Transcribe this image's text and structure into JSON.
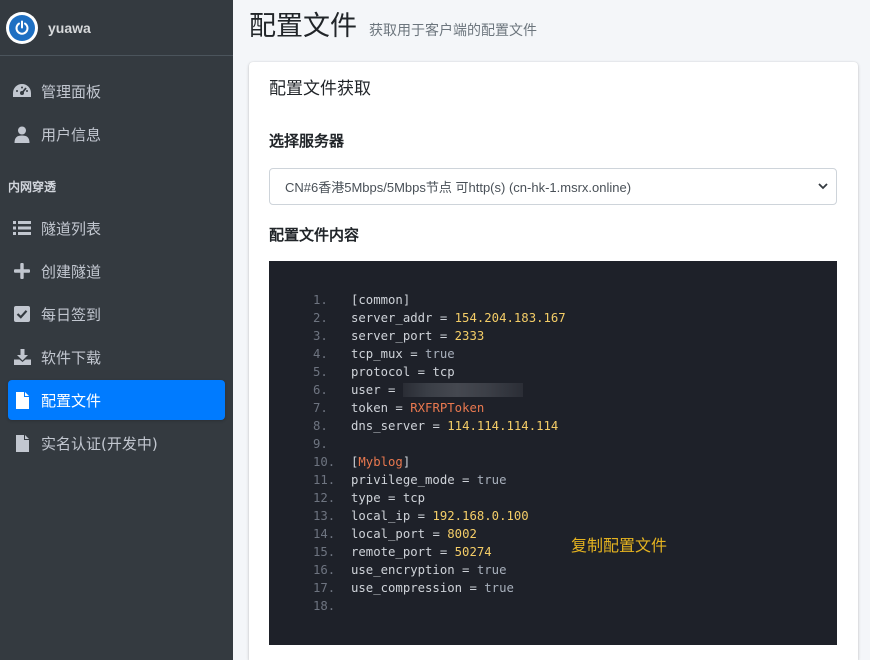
{
  "brand": {
    "name": "yuawa"
  },
  "sidebar": {
    "items_top": [
      {
        "label": "管理面板",
        "icon": "dashboard-icon"
      },
      {
        "label": "用户信息",
        "icon": "user-icon"
      }
    ],
    "section_header": "内网穿透",
    "items": [
      {
        "label": "隧道列表",
        "icon": "list-icon"
      },
      {
        "label": "创建隧道",
        "icon": "plus-icon"
      },
      {
        "label": "每日签到",
        "icon": "check-square-icon"
      },
      {
        "label": "软件下载",
        "icon": "download-icon"
      },
      {
        "label": "配置文件",
        "icon": "file-icon",
        "active": true
      },
      {
        "label": "实名认证(开发中)",
        "icon": "file-icon"
      }
    ]
  },
  "header": {
    "title": "配置文件",
    "subtitle": "获取用于客户端的配置文件"
  },
  "card": {
    "title": "配置文件获取",
    "server_label": "选择服务器",
    "server_selected": "CN#6香港5Mbps/5Mbps节点 可http(s) (cn-hk-1.msrx.online)",
    "content_label": "配置文件内容",
    "copy_label": "复制配置文件"
  },
  "code": {
    "line_numbers": [
      "1.",
      "2.",
      "3.",
      "4.",
      "5.",
      "6.",
      "7.",
      "8.",
      "9.",
      "10.",
      "11.",
      "12.",
      "13.",
      "14.",
      "15.",
      "16.",
      "17.",
      "18."
    ],
    "common_section": "common",
    "server_addr": "154.204.183.167",
    "server_port": "2333",
    "tcp_mux": "true",
    "protocol": "tcp",
    "token": "RXFRPToken",
    "dns_server": "114.114.114.114",
    "tunnel_section": "Myblog",
    "privilege_mode": "true",
    "type": "tcp",
    "local_ip": "192.168.0.100",
    "local_port": "8002",
    "remote_port": "50274",
    "use_encryption": "true",
    "use_compression": "true",
    "keys": {
      "server_addr": "server_addr",
      "server_port": "server_port",
      "tcp_mux": "tcp_mux",
      "protocol": "protocol",
      "user": "user",
      "token": "token",
      "dns_server": "dns_server",
      "privilege_mode": "privilege_mode",
      "type": "type",
      "local_ip": "local_ip",
      "local_port": "local_port",
      "remote_port": "remote_port",
      "use_encryption": "use_encryption",
      "use_compression": "use_compression"
    }
  },
  "colors": {
    "sidebar_bg": "#343a40",
    "active_item": "#007bff",
    "code_bg": "#1e2129",
    "number_token": "#f4cd67",
    "string_token": "#e9784f",
    "copy_text": "#e5b320"
  }
}
